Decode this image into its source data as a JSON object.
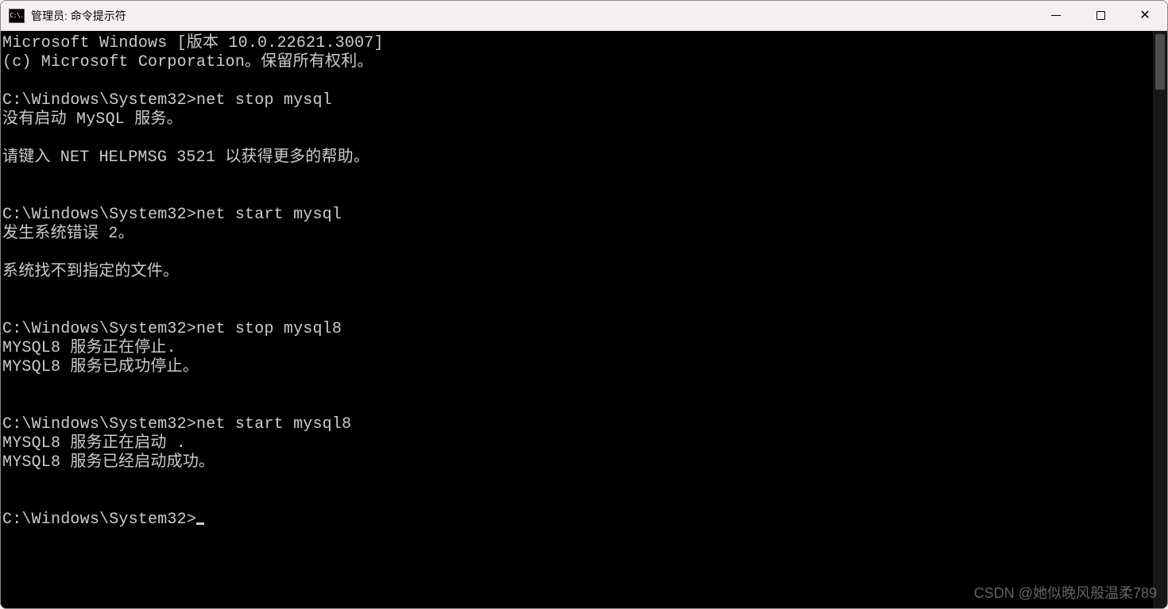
{
  "titlebar": {
    "icon_text": "C:\\.",
    "title": "管理员: 命令提示符"
  },
  "terminal": {
    "header_line1": "Microsoft Windows [版本 10.0.22621.3007]",
    "header_line2": "(c) Microsoft Corporation。保留所有权利。",
    "prompt": "C:\\Windows\\System32>",
    "block1": {
      "cmd": "net stop mysql",
      "out1": "没有启动 MySQL 服务。",
      "out2": "请键入 NET HELPMSG 3521 以获得更多的帮助。"
    },
    "block2": {
      "cmd": "net start mysql",
      "out1": "发生系统错误 2。",
      "out2": "系统找不到指定的文件。"
    },
    "block3": {
      "cmd": "net stop mysql8",
      "out1": "MYSQL8 服务正在停止.",
      "out2": "MYSQL8 服务已成功停止。"
    },
    "block4": {
      "cmd": "net start mysql8",
      "out1": "MYSQL8 服务正在启动 .",
      "out2": "MYSQL8 服务已经启动成功。"
    }
  },
  "watermark": "CSDN @她似晚风般温柔789"
}
